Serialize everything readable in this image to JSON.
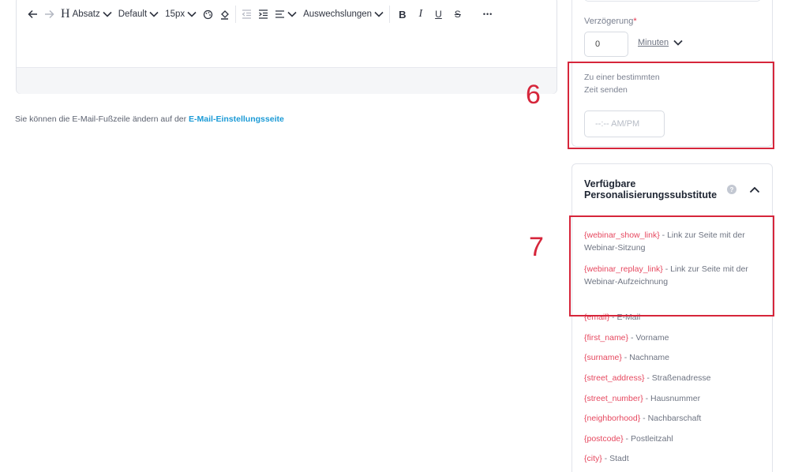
{
  "toolbar": {
    "paragraph_label": "Absatz",
    "font_label": "Default",
    "size_label": "15px",
    "replacements_label": "Auswechslungen",
    "bold": "B",
    "italic": "I",
    "underline": "U",
    "strike": "S",
    "more": "•••"
  },
  "footer_note": {
    "text": "Sie können die E-Mail-Fußzeile ändern auf der ",
    "link": "E-Mail-Einstellungsseite"
  },
  "delay": {
    "label": "Verzögerung",
    "required_mark": "*",
    "value": "0",
    "unit": "Minuten"
  },
  "send_at_time": {
    "label": "Zu einer bestimmten Zeit senden",
    "placeholder": "--:-- AM/PM"
  },
  "personalization": {
    "title": "Verfügbare Personalisierungssubstitute",
    "help": "?",
    "items": [
      {
        "tag": "{webinar_show_link}",
        "desc": " - Link zur Seite mit der Webinar-Sitzung"
      },
      {
        "tag": "{webinar_replay_link}",
        "desc": " - Link zur Seite mit der Webinar-Aufzeichnung"
      },
      {
        "tag": "{email}",
        "desc": " - E-Mail"
      },
      {
        "tag": "{first_name}",
        "desc": " - Vorname"
      },
      {
        "tag": "{surname}",
        "desc": " - Nachname"
      },
      {
        "tag": "{street_address}",
        "desc": " - Straßenadresse"
      },
      {
        "tag": "{street_number}",
        "desc": " - Hausnummer"
      },
      {
        "tag": "{neighborhood}",
        "desc": " - Nachbarschaft"
      },
      {
        "tag": "{postcode}",
        "desc": " - Postleitzahl"
      },
      {
        "tag": "{city}",
        "desc": " - Stadt"
      }
    ]
  },
  "annotations": {
    "six": "6",
    "seven": "7"
  },
  "colors": {
    "annotation_red": "#d6263b",
    "tag_pink": "#e6485f",
    "link_blue": "#1b9ad6"
  }
}
